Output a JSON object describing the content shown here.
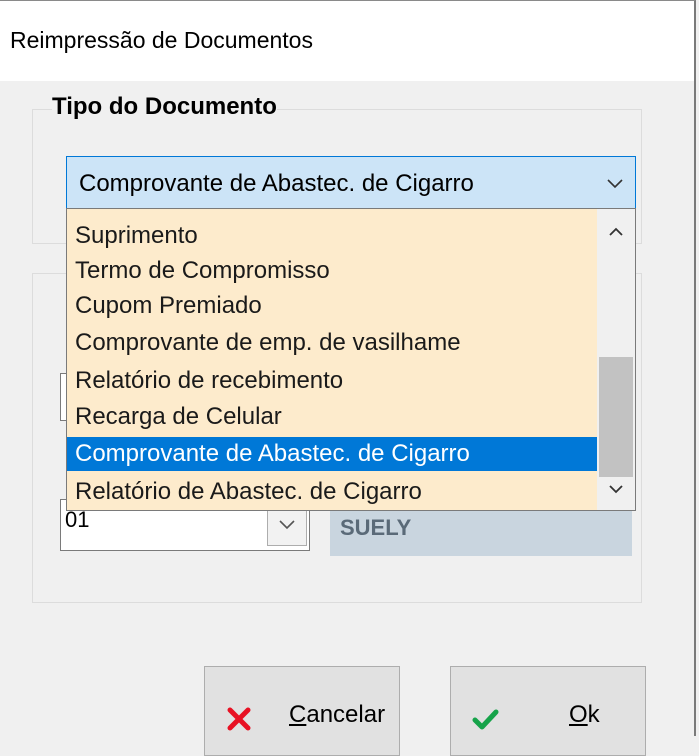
{
  "window": {
    "title": "Reimpressão de Documentos"
  },
  "doc_group": {
    "legend": "Tipo do Documento",
    "combo": {
      "value": "Comprovante de Abastec. de Cigarro",
      "arrow_icon": "chevron-down-icon"
    }
  },
  "dropdown": {
    "items": [
      "Suprimento",
      "Termo de Compromisso",
      "Cupom Premiado",
      "Comprovante de emp. de vasilhame",
      "Relatório de recebimento",
      "Recarga de Celular",
      "Comprovante de Abastec. de Cigarro",
      "Relatório de Abastec. de Cigarro"
    ],
    "selected_index": 6,
    "selected_color": "#0078d7",
    "background_color": "#fdebcc"
  },
  "operator": {
    "code": "01",
    "name": "SUELY"
  },
  "buttons": {
    "cancel": {
      "first": "C",
      "rest": "ancelar",
      "icon": "x-icon",
      "icon_color": "#e81123"
    },
    "ok": {
      "first": "O",
      "rest": "k",
      "icon": "check-icon",
      "icon_color": "#16a34a"
    }
  }
}
